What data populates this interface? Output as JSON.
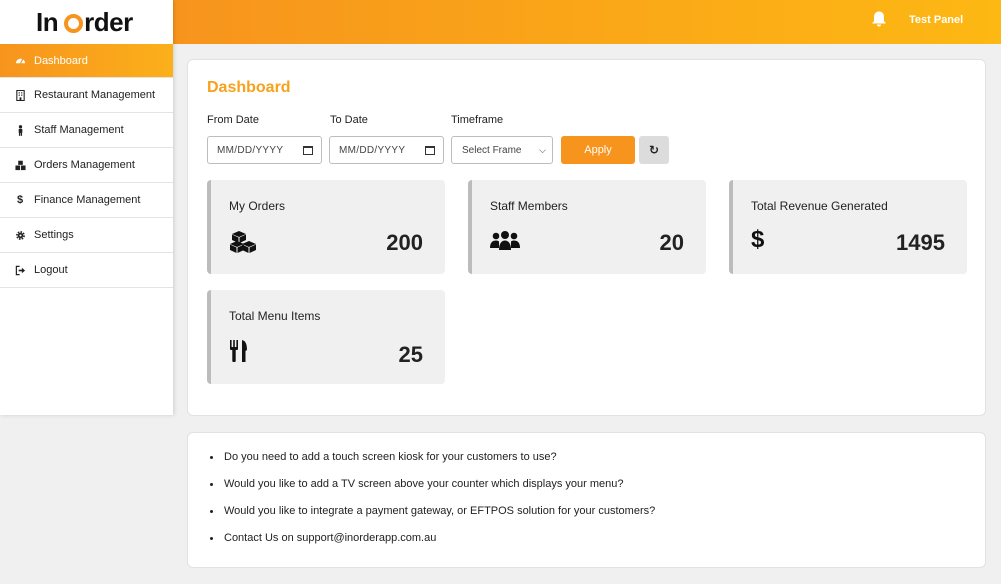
{
  "brand": {
    "logo_left": "In",
    "logo_right": "rder"
  },
  "topbar": {
    "panel_label": "Test Panel"
  },
  "sidebar": {
    "items": [
      {
        "label": "Dashboard",
        "icon": "dashboard-icon"
      },
      {
        "label": "Restaurant Management",
        "icon": "building-icon"
      },
      {
        "label": "Staff Management",
        "icon": "person-icon"
      },
      {
        "label": "Orders Management",
        "icon": "cubes-icon"
      },
      {
        "label": "Finance Management",
        "icon": "dollar-icon"
      },
      {
        "label": "Settings",
        "icon": "gear-icon"
      },
      {
        "label": "Logout",
        "icon": "logout-icon"
      }
    ]
  },
  "dashboard": {
    "title": "Dashboard",
    "filters": {
      "from_label": "From Date",
      "from_placeholder": "MM/DD/YYYY",
      "to_label": "To Date",
      "to_placeholder": "MM/DD/YYYY",
      "timeframe_label": "Timeframe",
      "timeframe_selected": "Select Frame",
      "apply_label": "Apply",
      "refresh_symbol": "↻"
    },
    "stats": [
      {
        "label": "My Orders",
        "value": "200",
        "icon": "cubes-icon"
      },
      {
        "label": "Staff Members",
        "value": "20",
        "icon": "users-icon"
      },
      {
        "label": "Total Revenue Generated",
        "value": "1495",
        "icon": "dollar-icon",
        "icon_glyph": "$"
      },
      {
        "label": "Total Menu Items",
        "value": "25",
        "icon": "utensils-icon"
      }
    ]
  },
  "info": {
    "items": [
      "Do you need to add a touch screen kiosk for your customers to use?",
      "Would you like to add a TV screen above your counter which displays your menu?",
      "Would you like to integrate a payment gateway, or EFTPOS solution for your customers?",
      "Contact Us on support@inorderapp.com.au"
    ]
  },
  "colors": {
    "accent": "#f7941d",
    "accent_light": "#fdb813",
    "title": "#f7a21d"
  }
}
